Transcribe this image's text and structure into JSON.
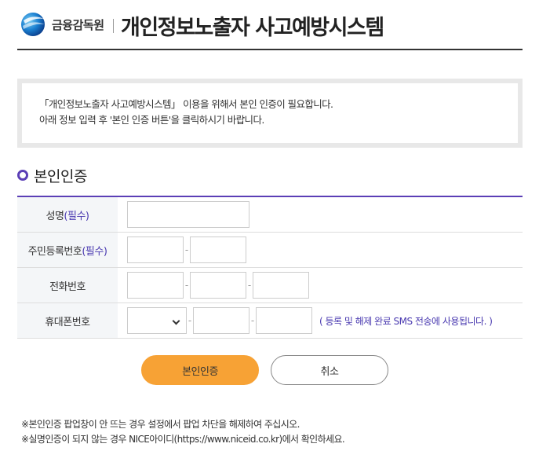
{
  "header": {
    "org_name": "금융감독원",
    "title": "개인정보노출자 사고예방시스템"
  },
  "notice": {
    "line1": "「개인정보노출자 사고예방시스템」 이용을 위해서 본인 인증이 필요합니다.",
    "line2": "아래 정보 입력 후 '본인 인증 버튼'을 클릭하시기 바랍니다."
  },
  "section": {
    "title": "본인인증"
  },
  "form": {
    "name_label": "성명",
    "required_tag": "(필수)",
    "rrn_label": "주민등록번호",
    "phone_label": "전화번호",
    "mobile_label": "휴대폰번호",
    "separator": "-",
    "sms_note": "( 등록 및 해제 완료 SMS 전송에 사용됩니다. )"
  },
  "buttons": {
    "auth": "본인인증",
    "cancel": "취소"
  },
  "notes": {
    "line1": "※본인인증 팝업창이 안 뜨는 경우 설정에서 팝업 차단을 해제하여 주십시오.",
    "line2": "※실명인증이 되지 않는 경우 NICE아이디(https://www.niceid.co.kr)에서 확인하세요."
  },
  "colors": {
    "accent": "#5b3fb6",
    "primary_button": "#f7a235",
    "required_text": "#4a3ab0"
  }
}
